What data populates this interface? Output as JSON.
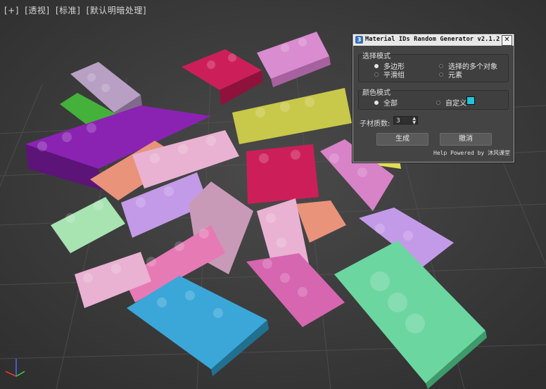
{
  "viewport": {
    "labels": [
      "[+]",
      "[透视]",
      "[标准]",
      "[默认明暗处理]"
    ]
  },
  "dialog": {
    "title": "Material IDs Random Generator v2.1.2",
    "close": "✕",
    "app_icon": "3",
    "select_mode": {
      "label": "选择模式",
      "options": [
        "多边形",
        "选择的多个对象",
        "平滑组",
        "元素"
      ],
      "selected": "多边形"
    },
    "color_mode": {
      "label": "颜色模式",
      "options": [
        "全部",
        "自定义"
      ],
      "selected": "全部",
      "swatch_color": "#22c4d8"
    },
    "sub_material": {
      "label": "子材质数:",
      "value": "3"
    },
    "buttons": {
      "generate": "生成",
      "cancel": "撤消"
    },
    "footer": "Help Powered by 沐风课堂"
  }
}
